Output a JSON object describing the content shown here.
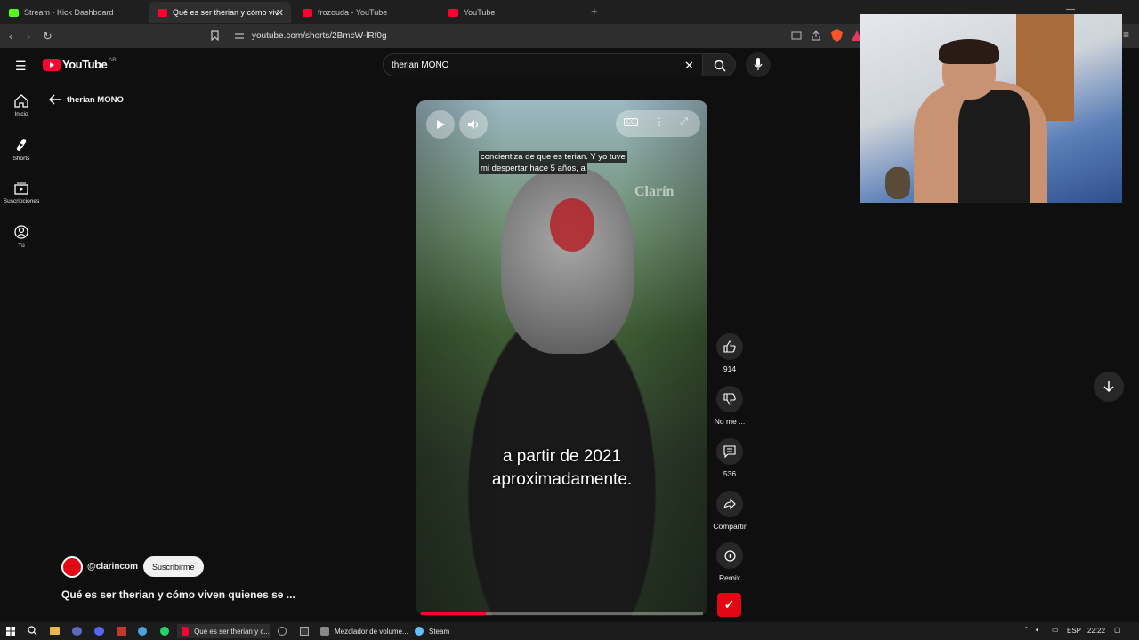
{
  "browser": {
    "tabs": [
      {
        "title": "Stream - Kick Dashboard",
        "favicon_color": "#53fc18"
      },
      {
        "title": "Qué es ser therian y cómo viven",
        "favicon_color": "#ff0033"
      },
      {
        "title": "frozouda - YouTube",
        "favicon_color": "#ff0033"
      },
      {
        "title": "YouTube",
        "favicon_color": "#ff0033"
      }
    ],
    "url": "youtube.com/shorts/2BmcW-lRf0g"
  },
  "youtube": {
    "logo_text": "YouTube",
    "country": "AR",
    "search_value": "therian MONO",
    "sidebar": [
      {
        "label": "Inicio",
        "icon": "home-icon"
      },
      {
        "label": "Shorts",
        "icon": "shorts-icon"
      },
      {
        "label": "Suscripciones",
        "icon": "subscriptions-icon"
      },
      {
        "label": "Tú",
        "icon": "you-icon"
      }
    ],
    "back_title": "therian MONO",
    "channel": {
      "handle": "@clarincom",
      "subscribe_label": "Suscribirme"
    },
    "video_title": "Qué es ser therian y cómo viven quienes se ...",
    "video": {
      "caption_top_line1": "concientiza de que es terian. Y yo tuve",
      "caption_top_line2": "mi despertar hace 5 años, a",
      "watermark": "Clarín",
      "subtitle_line1": "a partir de 2021",
      "subtitle_line2": "aproximadamente.",
      "progress_percent": 23
    },
    "actions": {
      "likes": "914",
      "dislike_label": "No me ...",
      "comments": "536",
      "share_label": "Compartir",
      "remix_label": "Remix"
    }
  },
  "taskbar": {
    "apps": [
      {
        "label": "Qué es ser therian y c...",
        "color": "#ff0033"
      },
      {
        "label": "Mezclador de volume...",
        "color": "#888888"
      },
      {
        "label": "Steam",
        "color": "#66c0f4"
      }
    ],
    "language": "ESP",
    "time": "22:22"
  },
  "colors": {
    "accent": "#ff0033",
    "background": "#0f0f0f",
    "clarin_red": "#e30613"
  }
}
